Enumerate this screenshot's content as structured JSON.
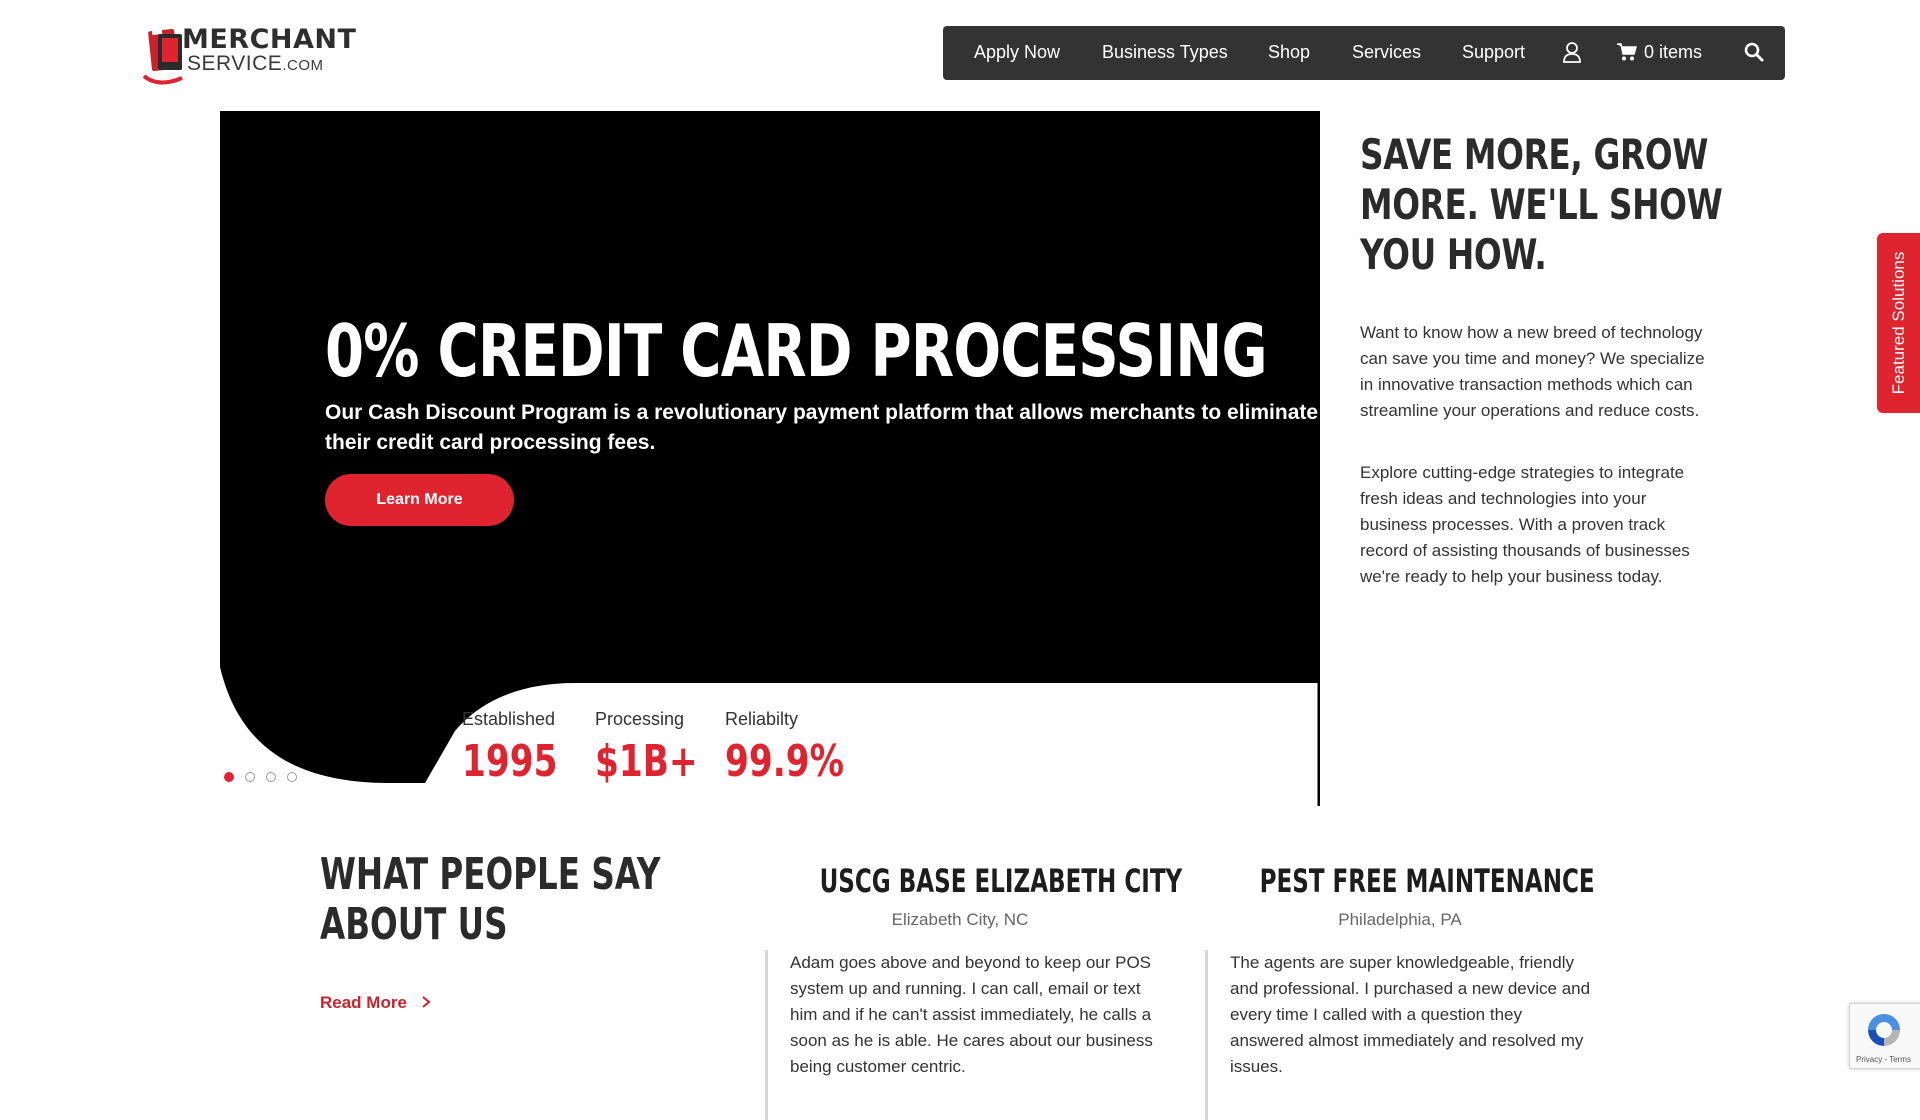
{
  "header": {
    "logo_text_1": "MERCHANT",
    "logo_text_2": "SERVICE",
    "logo_text_3": ".COM",
    "nav": [
      "Apply Now",
      "Business Types",
      "Shop",
      "Services",
      "Support"
    ],
    "cart_label": "0 items",
    "icons": [
      "user-icon",
      "cart-icon",
      "search-icon"
    ]
  },
  "hero": {
    "title": "0% CREDIT CARD PROCESSING",
    "subtitle": "Our Cash Discount Program is a revolutionary payment platform that allows merchants to eliminate their credit card processing fees.",
    "cta": "Learn More",
    "stats": [
      {
        "label": "Established",
        "value": "1995"
      },
      {
        "label": "Processing",
        "value": "$1B+"
      },
      {
        "label": "Reliabilty",
        "value": "99.9%"
      }
    ],
    "slides_total": 4,
    "active_slide": 1
  },
  "promo": {
    "title_lines": [
      "SAVE MORE, GROW",
      "MORE. WE'LL SHOW",
      "YOU HOW."
    ],
    "paragraph1": "Want to know how a new breed of technology can save you time and money?  We specialize in innovative transaction methods which can streamline your operations and reduce costs.",
    "paragraph2": "Explore cutting-edge strategies to integrate fresh ideas and technologies into your business processes. With a proven track record of assisting thousands of businesses we're ready to help your business today."
  },
  "featured_tab": "Featured Solutions",
  "testimonials": {
    "title_lines": [
      "WHAT PEOPLE SAY",
      "ABOUT US"
    ],
    "read_more": "Read More",
    "items": [
      {
        "name": "USCG BASE ELIZABETH CITY",
        "location": "Elizabeth City, NC",
        "quote": "Adam goes above and beyond to keep our POS system up and running. I can call, email or text him and if he can't assist immediately, he calls a soon as he is able. He cares about our business being customer centric."
      },
      {
        "name": "PEST FREE MAINTENANCE",
        "location": "Philadelphia, PA",
        "quote": "The agents are super knowledgeable, friendly and professional. I purchased a new device and every time I called with a question they answered almost immediately and resolved my issues."
      }
    ]
  },
  "recaptcha_text": "Privacy - Terms",
  "colors": {
    "accent": "#e0242f",
    "nav_bg": "#333333",
    "hero_bg": "#000000"
  }
}
